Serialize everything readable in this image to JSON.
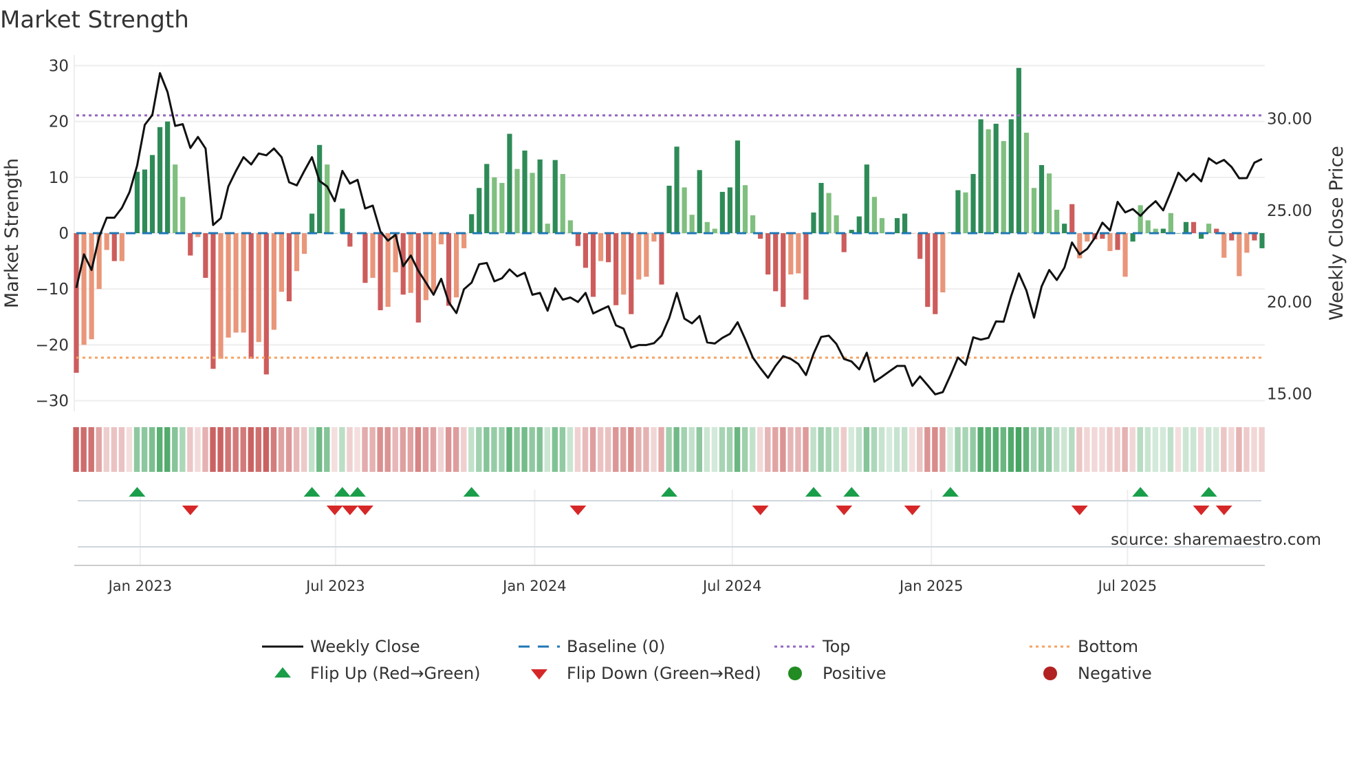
{
  "chart_data": {
    "type": "bar",
    "title": "Market Strength",
    "ylabel_left": "Market Strength",
    "ylabel_right": "Weekly Close Price",
    "ylim_left": [
      -32,
      32
    ],
    "ylim_right": [
      13.4,
      33.3
    ],
    "yticks_left": [
      30,
      20,
      10,
      0,
      -10,
      -20,
      -30
    ],
    "ytick_labels_left": [
      "30",
      "20",
      "10",
      "0",
      "−10",
      "−20",
      "−30"
    ],
    "yticks_right": [
      30,
      25,
      20,
      15
    ],
    "ytick_labels_right": [
      "30.00",
      "25.00",
      "20.00",
      "15.00"
    ],
    "x_ticks": [
      {
        "label": "Jan 2023",
        "week": 8.4
      },
      {
        "label": "Jul 2023",
        "week": 34.1
      },
      {
        "label": "Jan 2024",
        "week": 60.3
      },
      {
        "label": "Jul 2024",
        "week": 86.3
      },
      {
        "label": "Jan 2025",
        "week": 112.5
      },
      {
        "label": "Jul 2025",
        "week": 138.3
      }
    ],
    "top_level": 21.1,
    "bottom_level": -22.3,
    "baseline": 0,
    "strength": [
      -25,
      -20,
      -19,
      -10,
      -3,
      -5,
      -5,
      0,
      11,
      11.4,
      14,
      19,
      20,
      12.3,
      6.5,
      -4,
      -0.7,
      -8,
      -24.3,
      -22.5,
      -18.7,
      -17.8,
      -17.8,
      -22.5,
      -19.5,
      -25.3,
      -17.3,
      -10.5,
      -12.2,
      -6.8,
      -3.7,
      3.5,
      15.8,
      12.3,
      0,
      4.4,
      -2.4,
      0,
      -8.9,
      -8,
      -13.8,
      -13.2,
      -7,
      -11,
      -10.7,
      -16,
      -12,
      -10.5,
      -2,
      -13,
      -11.5,
      -2.7,
      3.4,
      8.1,
      12.4,
      10,
      9,
      17.8,
      11.5,
      14.8,
      10.8,
      13.2,
      1.7,
      13.1,
      10.6,
      2.3,
      -2.3,
      -6.2,
      -11.4,
      -5,
      -5.2,
      -12.9,
      -11,
      -14.5,
      -8.3,
      -7.8,
      -1.5,
      -9.2,
      8.5,
      15.5,
      8.2,
      3.3,
      11.3,
      2,
      0.8,
      7.4,
      8.2,
      16.6,
      8.6,
      3.2,
      -1,
      -7.4,
      -10.4,
      -13.2,
      -7.4,
      -7.2,
      -11.9,
      3.7,
      9,
      7.2,
      3.2,
      -3.4,
      0.6,
      3,
      12.3,
      6.5,
      2.7,
      0.2,
      2.7,
      3.5,
      0,
      -4.6,
      -13.2,
      -14.5,
      -10.6,
      0.1,
      7.7,
      7.3,
      10.6,
      20.4,
      18.6,
      19.6,
      16.5,
      20.4,
      29.6,
      18,
      8.1,
      12.2,
      10.7,
      4.2,
      1.7,
      5.2,
      -4.5,
      -1.5,
      -1.1,
      -1,
      -3.2,
      -3,
      -7.8,
      -1.5,
      5,
      2.3,
      0.8,
      0.8,
      3.6,
      0,
      2,
      2,
      -1,
      1.7,
      0.8,
      -4.4,
      -1.3,
      -7.7,
      -3.5,
      -1.3,
      -2.7
    ],
    "shade": "RrrrrRrgGGGGGggRrRRrrrrRrRrrRrrGGggGRrRrRrrRrRrrrRrrGGGggGgGgGgGggRRRrRRrRrrrRG",
    "shade2": "GggGggGGGggRRRRrrRGGggRGGGgggGGrRRRrGGgGGgGgGGggGggGRrrRRrRrGgggGgGGRGgRrRrrR",
    "weekly_close": [
      20.77,
      22.6,
      21.75,
      23.57,
      24.6,
      24.6,
      25.14,
      26.0,
      27.44,
      29.66,
      30.2,
      32.48,
      31.45,
      29.6,
      29.7,
      28.4,
      29.0,
      28.37,
      24.2,
      24.57,
      26.3,
      27.15,
      27.9,
      27.5,
      28.1,
      28.0,
      28.37,
      27.9,
      26.53,
      26.36,
      27.15,
      27.9,
      26.6,
      26.3,
      25.5,
      27.15,
      26.46,
      26.66,
      25.1,
      25.26,
      23.85,
      23.35,
      23.67,
      21.95,
      22.54,
      21.7,
      21.06,
      20.4,
      21.27,
      19.99,
      19.4,
      20.7,
      21.06,
      22.06,
      22.13,
      21.13,
      21.3,
      21.78,
      21.4,
      21.6,
      20.4,
      20.5,
      19.53,
      20.75,
      20.13,
      20.25,
      20.0,
      20.5,
      19.38,
      19.58,
      19.77,
      18.73,
      18.55,
      17.52,
      17.66,
      17.66,
      17.76,
      18.17,
      19.13,
      20.5,
      19.1,
      18.84,
      19.24,
      17.8,
      17.74,
      18.05,
      18.27,
      18.9,
      17.98,
      16.98,
      16.4,
      15.87,
      16.52,
      17.05,
      16.9,
      16.62,
      16.02,
      17.19,
      18.1,
      18.17,
      17.72,
      16.9,
      16.76,
      16.33,
      17.24,
      15.66,
      15.93,
      16.23,
      16.52,
      16.52,
      15.43,
      15.95,
      15.47,
      14.97,
      15.09,
      16.0,
      16.98,
      16.58,
      18.08,
      17.95,
      18.05,
      18.95,
      18.93,
      20.34,
      21.56,
      20.63,
      19.15,
      20.85,
      21.75,
      21.2,
      21.88,
      23.25,
      22.6,
      22.9,
      23.5,
      24.33,
      23.9,
      25.46,
      24.89,
      25.07,
      24.7,
      25.14,
      25.5,
      25.0,
      26.0,
      27.05,
      26.6,
      27.0,
      26.58,
      27.84,
      27.55,
      27.75,
      27.36,
      26.75,
      26.76,
      27.6,
      27.8
    ],
    "flip_up_weeks": [
      8,
      31,
      35,
      37,
      52,
      78,
      97,
      102,
      115,
      140,
      149
    ],
    "flip_down_weeks": [
      15,
      34,
      36,
      38,
      66,
      90,
      101,
      110,
      132,
      148,
      151
    ],
    "legend": [
      {
        "label": "Weekly Close",
        "kind": "line"
      },
      {
        "label": "Baseline (0)",
        "kind": "dash"
      },
      {
        "label": "Top",
        "kind": "dot-top"
      },
      {
        "label": "Bottom",
        "kind": "dot-bottom"
      },
      {
        "label": "Flip Up (Red→Green)",
        "kind": "tri-up"
      },
      {
        "label": "Flip Down (Green→Red)",
        "kind": "tri-down"
      },
      {
        "label": "Positive",
        "kind": "dot-pos"
      },
      {
        "label": "Negative",
        "kind": "dot-neg"
      }
    ],
    "legend_placement": "bottom",
    "grid": true
  },
  "source": "source: sharemaestro.com",
  "colors": {
    "strong_pos": "#2e8b57",
    "weak_pos": "#7fbf7f",
    "strong_neg": "#cd5c5c",
    "weak_neg": "#e9967a",
    "baseline": "#1f77b4",
    "top": "#9467bd",
    "bottom": "#f4a261",
    "flip_up": "#1a9e4a",
    "flip_down": "#d62728",
    "positive": "#228b22",
    "negative": "#b22222",
    "line": "#111111"
  }
}
